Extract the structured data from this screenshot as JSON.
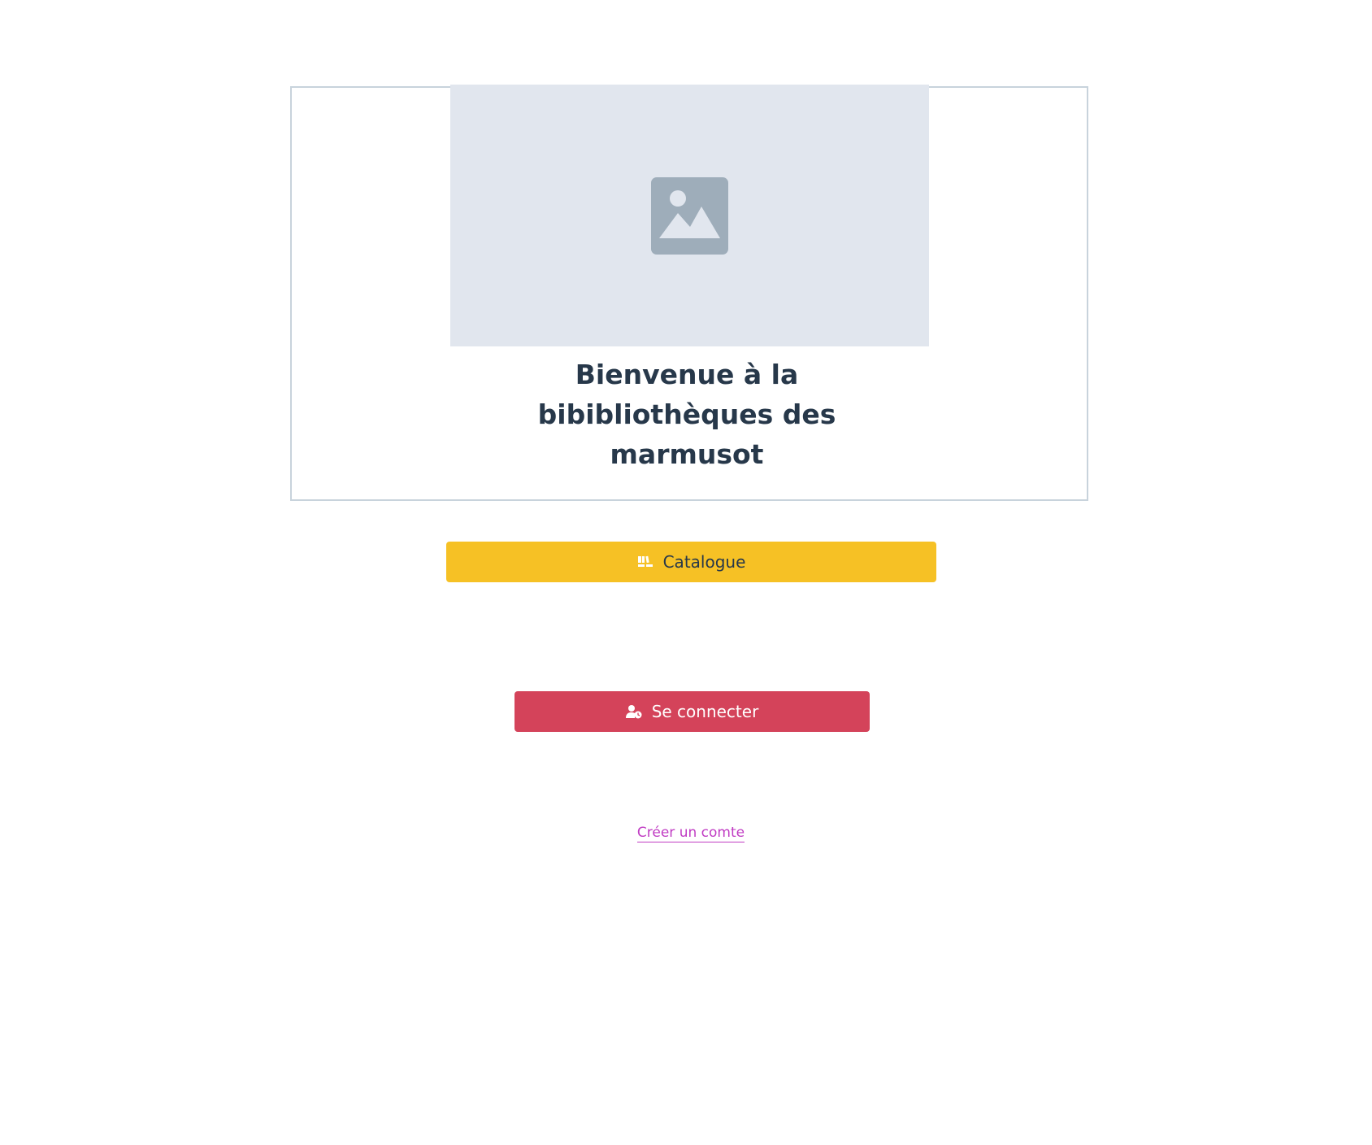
{
  "welcome": {
    "title_line1": "Bienvenue à la",
    "title_line2": "bibibliothèques des",
    "title_line3": "marmusot",
    "image_icon": "image-placeholder-icon"
  },
  "actions": {
    "catalogue_label": "Catalogue",
    "catalogue_icon": "books-icon",
    "login_label": "Se connecter",
    "login_icon": "user-clock-icon",
    "create_account_label": "Créer un comte"
  },
  "colors": {
    "catalogue_button": "#f6c125",
    "login_button": "#d4435a",
    "link": "#c03cc3",
    "title_text": "#27384a",
    "placeholder_bg": "#e1e6ee",
    "placeholder_icon": "#9eadba",
    "card_border": "#c8d3dc"
  }
}
